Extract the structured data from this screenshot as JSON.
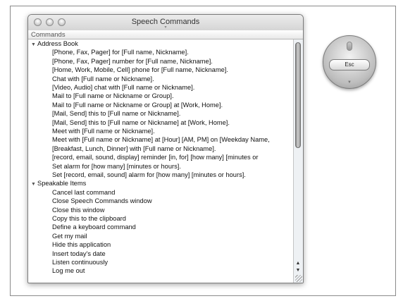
{
  "window": {
    "title": "Speech Commands",
    "column_header": "Commands"
  },
  "groups": [
    {
      "name": "Address Book",
      "items": [
        "[Phone, Fax, Pager] for [Full name, Nickname].",
        "[Phone, Fax, Pager] number for [Full name, Nickname].",
        "[Home, Work, Mobile, Cell] phone for [Full name, Nickname].",
        "Chat with [Full name or Nickname].",
        "[Video, Audio] chat with [Full name or Nickname].",
        "Mail to [Full name or Nickname or Group].",
        "Mail to [Full name or Nickname or Group] at [Work, Home].",
        "[Mail, Send] this to [Full name or Nickname].",
        "[Mail, Send] this to [Full name or Nickname] at [Work, Home].",
        "Meet with [Full name or Nickname].",
        "Meet with [Full name or Nickname] at [Hour] [AM, PM] on [Weekday Name,",
        "[Breakfast, Lunch, Dinner] with [Full name or Nickname].",
        "[record, email, sound, display] reminder [in, for] [how many] [minutes or",
        "Set alarm for [how many] [minutes or hours].",
        "Set [record, email, sound] alarm for [how many] [minutes or hours]."
      ]
    },
    {
      "name": "Speakable Items",
      "items": [
        "Cancel last command",
        "Close Speech Commands window",
        "Close this window",
        "Copy this to the clipboard",
        "Define a keyboard command",
        "Get my mail",
        "Hide this application",
        "Insert today's date",
        "Listen continuously",
        "Log me out"
      ]
    }
  ],
  "speech_widget": {
    "esc_label": "Esc"
  }
}
